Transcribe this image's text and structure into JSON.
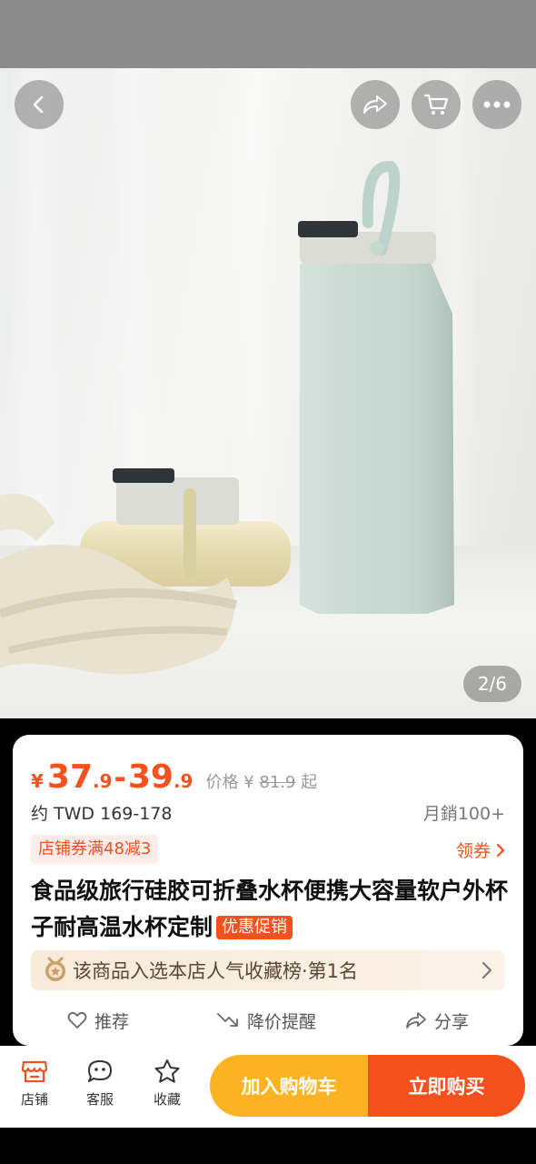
{
  "image_counter": "2/6",
  "price": {
    "currency": "¥",
    "low_int": "37",
    "low_dec": ".9",
    "dash": "-",
    "high_int": "39",
    "high_dec": ".9",
    "original_label": "价格 ¥",
    "original_value": "81.9",
    "original_suffix": "起"
  },
  "twd_range": "约 TWD 169-178",
  "monthly_sales": "月銷100+",
  "coupon_text": "店铺券满48减3",
  "get_coupon_label": "领券",
  "product_title": "食品级旅行硅胶可折叠水杯便携大容量软户外杯子耐高温水杯定制",
  "promo_badge": "优惠促销",
  "rank_text": "该商品入选本店人气收藏榜·第1名",
  "actions": {
    "recommend": "推荐",
    "price_alert": "降价提醒",
    "share": "分享"
  },
  "bottom_tabs": {
    "store": "店铺",
    "service": "客服",
    "favorite": "收藏"
  },
  "cta": {
    "add_to_cart": "加入购物车",
    "buy_now": "立即购买"
  },
  "colors": {
    "accent_orange": "#f4511e",
    "cart_yellow": "#fbb321"
  }
}
